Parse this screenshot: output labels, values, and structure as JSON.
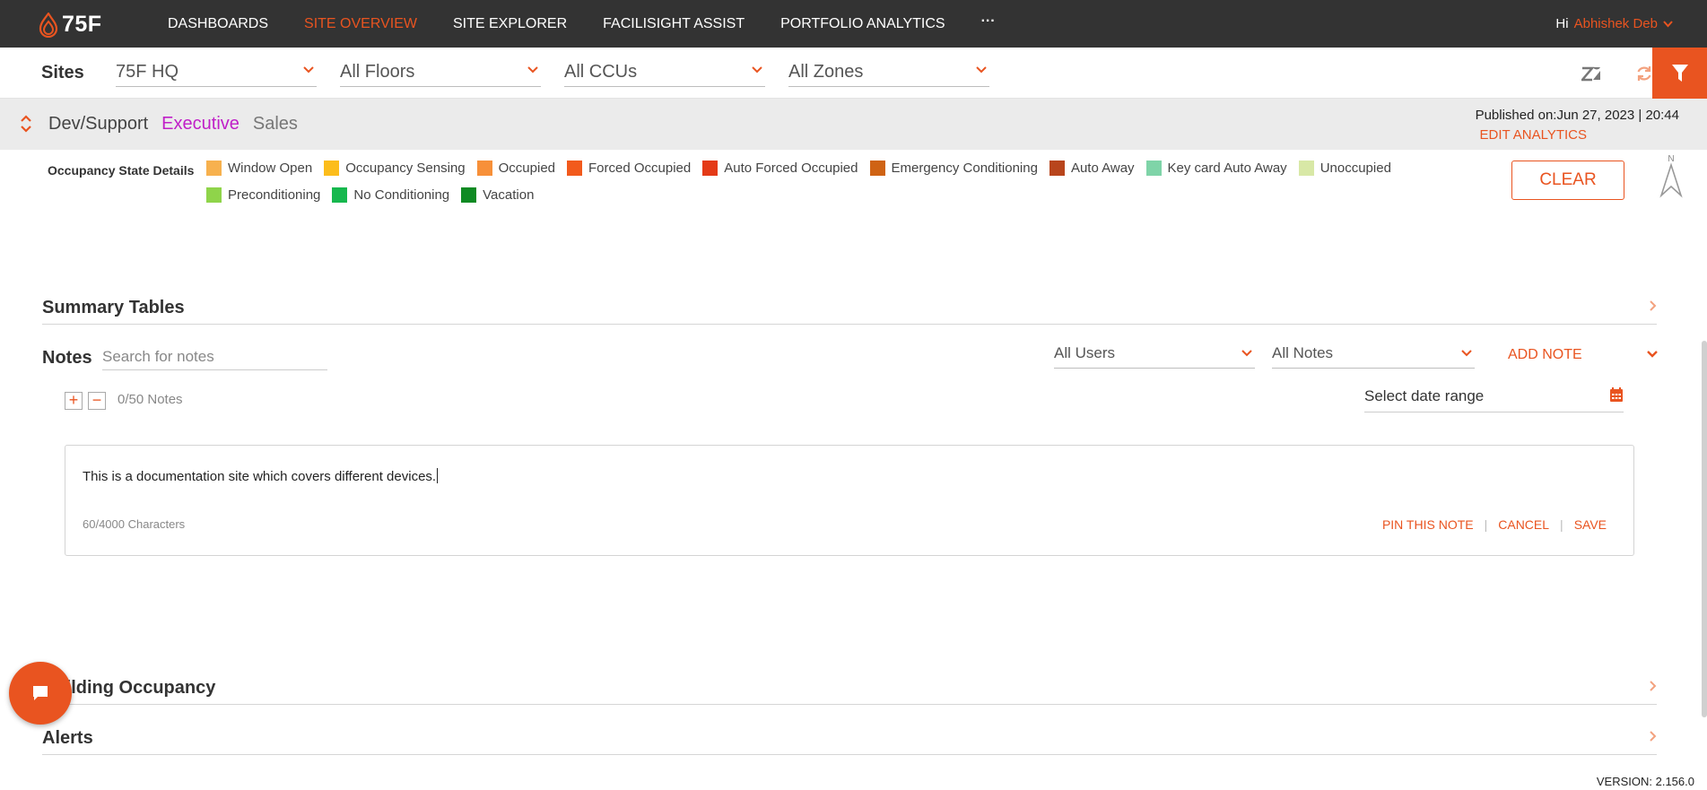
{
  "topnav": {
    "logo_text": "75F",
    "items": [
      {
        "label": "DASHBOARDS",
        "active": false
      },
      {
        "label": "SITE OVERVIEW",
        "active": true
      },
      {
        "label": "SITE EXPLORER",
        "active": false
      },
      {
        "label": "FACILISIGHT ASSIST",
        "active": false
      },
      {
        "label": "PORTFOLIO ANALYTICS",
        "active": false
      }
    ],
    "more_label": "···",
    "greeting": "Hi",
    "user_name": "Abhishek Deb"
  },
  "filters": {
    "sites_label": "Sites",
    "site": "75F HQ",
    "floors": "All Floors",
    "ccus": "All CCUs",
    "zones": "All Zones"
  },
  "dashboard": {
    "tabs": [
      {
        "label": "Dev/Support"
      },
      {
        "label": "Executive"
      },
      {
        "label": "Sales"
      }
    ],
    "published": "Published on:Jun 27, 2023 | 20:44",
    "edit_analytics": "EDIT ANALYTICS"
  },
  "legend": {
    "title": "Occupancy State Details",
    "items": [
      {
        "label": "Window Open",
        "color": "#f7b14e"
      },
      {
        "label": "Occupancy Sensing",
        "color": "#fcbd1b"
      },
      {
        "label": "Occupied",
        "color": "#f79039"
      },
      {
        "label": "Forced Occupied",
        "color": "#f25a1c"
      },
      {
        "label": "Auto Forced Occupied",
        "color": "#e43a17"
      },
      {
        "label": "Emergency Conditioning",
        "color": "#cf6314"
      },
      {
        "label": "Auto Away",
        "color": "#b8451c"
      },
      {
        "label": "Key card Auto Away",
        "color": "#7fd4a8"
      },
      {
        "label": "Unoccupied",
        "color": "#d8e8a6"
      },
      {
        "label": "Preconditioning",
        "color": "#8fd44a"
      },
      {
        "label": "No Conditioning",
        "color": "#16b84e"
      },
      {
        "label": "Vacation",
        "color": "#0e8a23"
      }
    ],
    "clear_label": "CLEAR",
    "compass_label": "N"
  },
  "sections": {
    "summary_tables": "Summary Tables",
    "building_occupancy": "Building Occupancy",
    "alerts": "Alerts"
  },
  "notes": {
    "label": "Notes",
    "search_placeholder": "Search for notes",
    "users_filter": "All Users",
    "notes_filter": "All Notes",
    "add_note": "ADD NOTE",
    "count": "0/50 Notes",
    "date_range": "Select date range",
    "editor": {
      "text": "This is a documentation site which covers different devices.",
      "char_count": "60/4000 Characters",
      "pin": "PIN THIS NOTE",
      "cancel": "CANCEL",
      "save": "SAVE"
    }
  },
  "version": "VERSION: 2.156.0",
  "accent_color": "#e95420"
}
